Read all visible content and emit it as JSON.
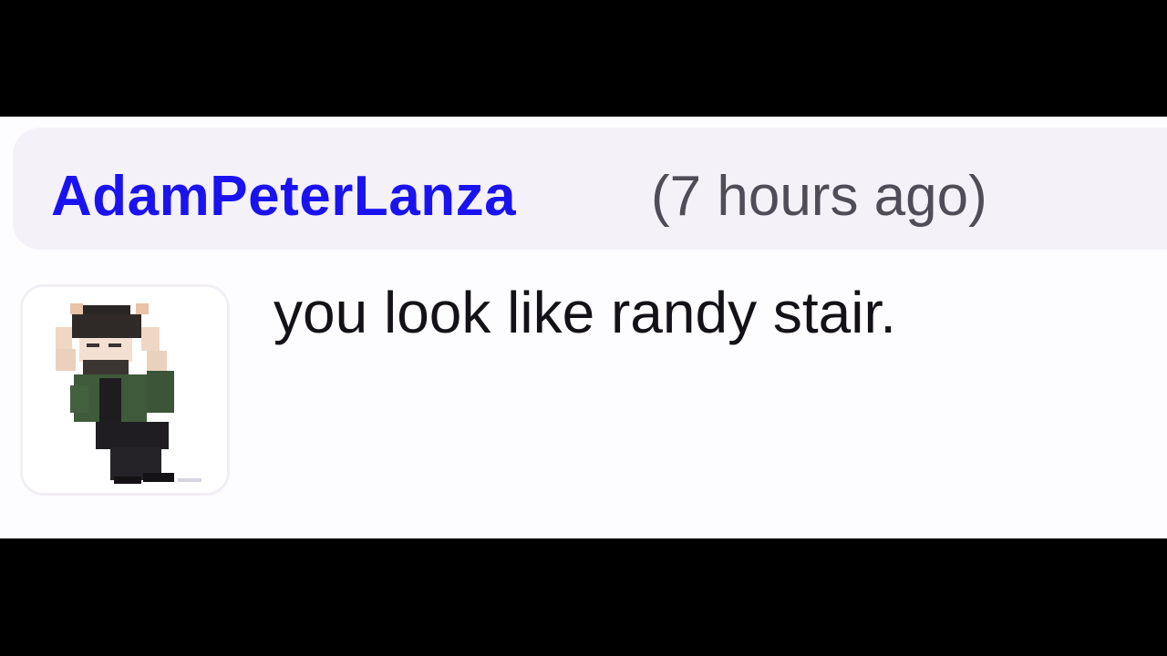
{
  "comment": {
    "username": "AdamPeterLanza",
    "timestamp": "(7 hours ago)",
    "body": "you look like randy stair."
  },
  "avatar": {
    "icon": "pixel-art-character-avatar"
  },
  "colors": {
    "username": "#1a13f0",
    "timestamp": "#504c58",
    "body_text": "#141218",
    "header_background": "#f4f2f8",
    "card_background": "#fdfcfe",
    "letterbox": "#000000"
  }
}
